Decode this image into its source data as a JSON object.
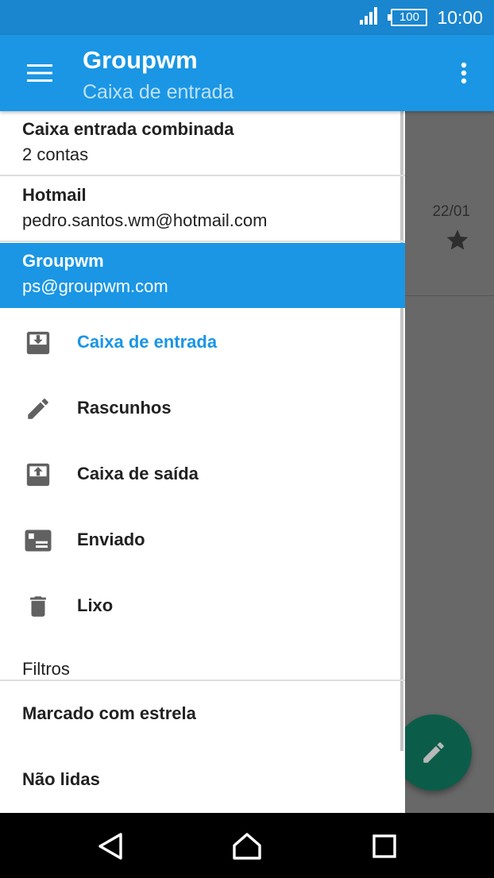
{
  "status_bar": {
    "battery": "100",
    "time": "10:00"
  },
  "app_bar": {
    "title": "Groupwm",
    "subtitle": "Caixa de entrada"
  },
  "drawer": {
    "accounts": [
      {
        "name": "Caixa entrada combinada",
        "detail": "2 contas"
      },
      {
        "name": "Hotmail",
        "detail": "pedro.santos.wm@hotmail.com"
      },
      {
        "name": "Groupwm",
        "detail": "ps@groupwm.com"
      }
    ],
    "folders": [
      {
        "label": "Caixa de entrada",
        "icon": "inbox-icon"
      },
      {
        "label": "Rascunhos",
        "icon": "pencil-icon"
      },
      {
        "label": "Caixa de saída",
        "icon": "outbox-icon"
      },
      {
        "label": "Enviado",
        "icon": "sent-icon"
      },
      {
        "label": "Lixo",
        "icon": "trash-icon"
      }
    ],
    "filters_header": "Filtros",
    "filters": [
      {
        "label": "Marcado com estrela"
      },
      {
        "label": "Não lidas"
      }
    ]
  },
  "background": {
    "message_date": "22/01"
  },
  "colors": {
    "primary": "#1a96e4",
    "status_bar": "#1a86cf",
    "subtitle": "#bfe1f8",
    "fab": "#0b5d4a",
    "scrim": "#686868"
  }
}
